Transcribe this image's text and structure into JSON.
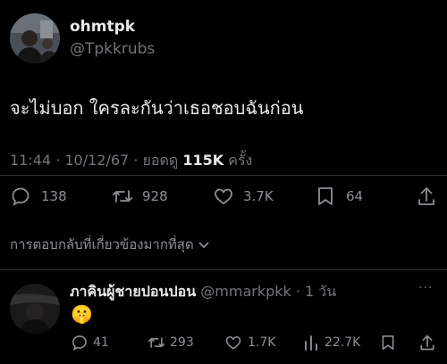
{
  "tweet": {
    "display_name": "ohmtpk",
    "handle": "@Tpkkrubs",
    "text": "จะไม่บอก ใครละกันว่าเธอชอบฉันก่อน",
    "time": "11:44 · 10/12/67 · ยอดดู ",
    "views": "115K",
    "views_suffix": " ครั้ง",
    "actions": {
      "replies": "138",
      "retweets": "928",
      "likes": "3.7K",
      "bookmarks": "64"
    }
  },
  "sort_label": "การตอบกลับที่เกี่ยวข้องมากที่สุด",
  "reply": {
    "display_name": "ภาคินผู้ชายปอนปอน",
    "handle_time": "@mmarkpkk · 1 วัน",
    "emoji": "🤫",
    "more": "···",
    "actions": {
      "replies": "41",
      "retweets": "293",
      "likes": "1.7K",
      "views": "22.7K"
    }
  },
  "colors": {
    "background": "#000000",
    "text": "#e7e9ea",
    "muted": "#71767b",
    "divider": "#2f3336"
  }
}
